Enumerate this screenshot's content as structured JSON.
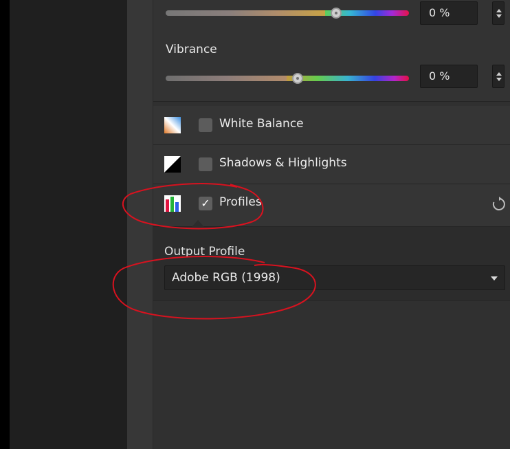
{
  "adjustments": {
    "saturation": {
      "value": "0 %"
    },
    "vibrance": {
      "label": "Vibrance",
      "value": "0 %"
    }
  },
  "panels": [
    {
      "label": "White Balance",
      "enabled": false,
      "icon": "white-balance-icon"
    },
    {
      "label": "Shadows & Highlights",
      "enabled": false,
      "icon": "shadows-highlights-icon"
    },
    {
      "label": "Profiles",
      "enabled": true,
      "icon": "profiles-icon",
      "checkmark": "✓",
      "action_icon": "reset-icon"
    }
  ],
  "output_profile": {
    "label": "Output Profile",
    "selected": "Adobe RGB (1998)"
  },
  "annotation_color": "#d8121f"
}
